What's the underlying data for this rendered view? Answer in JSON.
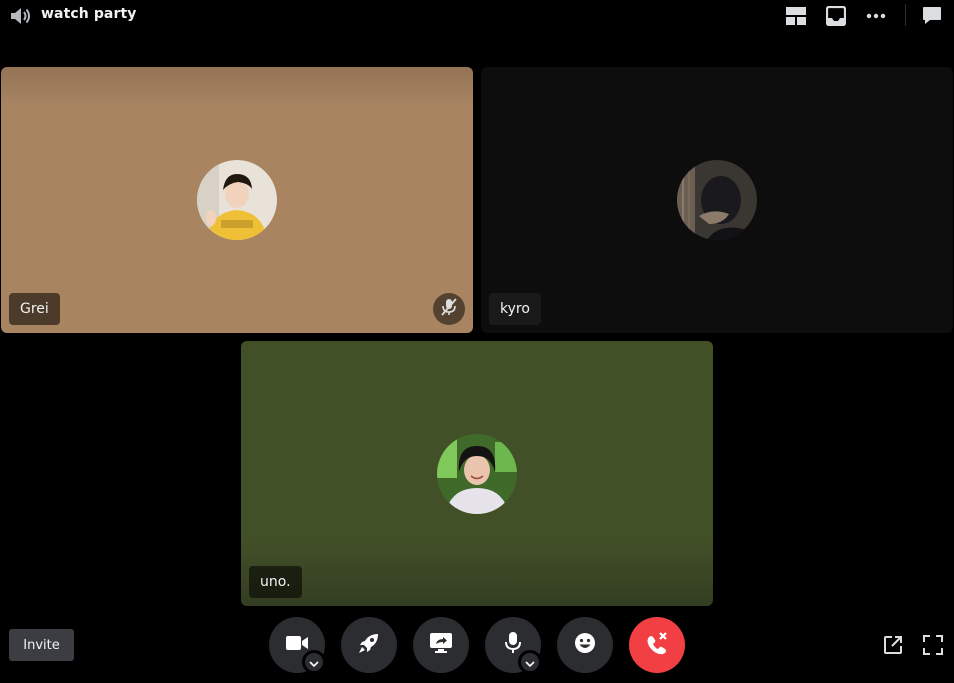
{
  "header": {
    "channel_name": "watch party",
    "icons": [
      "speaker-icon",
      "grid-layout-icon",
      "inbox-icon",
      "more-icon",
      "chat-icon"
    ]
  },
  "participants": [
    {
      "name": "Grei",
      "tile_color": "#a88461",
      "muted": true
    },
    {
      "name": "kyro",
      "tile_color": "#0d0d0d",
      "muted": false
    },
    {
      "name": "uno.",
      "tile_color": "#425028",
      "muted": false
    }
  ],
  "footer": {
    "invite_label": "Invite",
    "controls": [
      "camera-icon",
      "activity-rocket-icon",
      "screen-share-icon",
      "microphone-icon",
      "emoji-icon",
      "disconnect-icon"
    ],
    "corner_icons": [
      "popout-icon",
      "fullscreen-icon"
    ]
  },
  "colors": {
    "background": "#000000",
    "control_bg": "#2b2d31",
    "disconnect": "#f23f43",
    "invite_bg": "#3b3d42"
  }
}
